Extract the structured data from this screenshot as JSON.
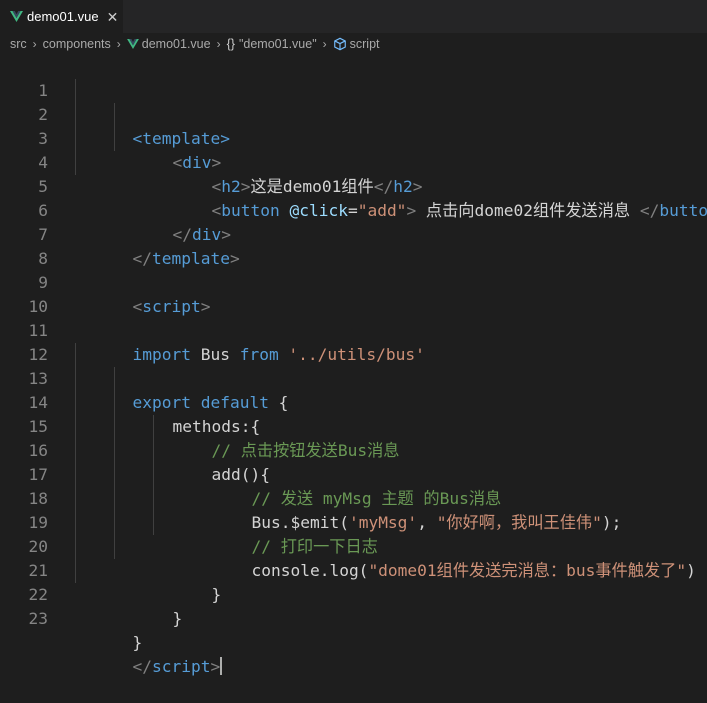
{
  "tab": {
    "title": "demo01.vue",
    "close": "✕"
  },
  "breadcrumb": {
    "items": [
      "src",
      "components",
      "demo01.vue",
      "\"demo01.vue\"",
      "script"
    ],
    "braces": "{}"
  },
  "code": {
    "l1": "<template>",
    "l2": {
      "open": "<",
      "tag": "div",
      "close": ">"
    },
    "l3": {
      "a": "<",
      "tag": "h2",
      "b": ">",
      "text": "这是demo01组件",
      "c": "</",
      "tag2": "h2",
      "d": ">"
    },
    "l4": {
      "a": "<",
      "tag": "button",
      "attr": " @click",
      "eq": "=",
      "val": "\"add\"",
      "b": ">",
      "text": " 点击向dome02组件发送消息 ",
      "c": "</",
      "tag2": "button",
      "d": ">"
    },
    "l5": {
      "a": "</",
      "tag": "div",
      "b": ">"
    },
    "l6": {
      "a": "</",
      "tag": "template",
      "b": ">"
    },
    "l8": {
      "a": "<",
      "tag": "script",
      "b": ">"
    },
    "l10": {
      "kw1": "import",
      "name": " Bus ",
      "kw2": "from",
      "str": " '../utils/bus'"
    },
    "l12": {
      "kw1": "export",
      "kw2": " default",
      "rest": " {"
    },
    "l13": "methods:{",
    "l14": "// 点击按钮发送Bus消息",
    "l15": "add(){",
    "l16": "// 发送 myMsg 主题 的Bus消息",
    "l17": {
      "a": "Bus.$emit(",
      "s1": "'myMsg'",
      "b": ", ",
      "s2": "\"你好啊，我叫王佳伟\"",
      "c": ");"
    },
    "l18": "// 打印一下日志",
    "l19": {
      "a": "console.log(",
      "s": "\"dome01组件发送完消息：bus事件触发了\"",
      "b": ")"
    },
    "l20": "}",
    "l21": "}",
    "l22": "}",
    "l23": {
      "a": "</",
      "tag": "script",
      "b": ">"
    }
  },
  "line_numbers": [
    "1",
    "2",
    "3",
    "4",
    "5",
    "6",
    "7",
    "8",
    "9",
    "10",
    "11",
    "12",
    "13",
    "14",
    "15",
    "16",
    "17",
    "18",
    "19",
    "20",
    "21",
    "22",
    "23"
  ],
  "colors": {
    "background": "#1e1e1e",
    "tag": "#569cd6",
    "string": "#ce9178",
    "comment": "#6a9955",
    "attribute": "#9cdcfe",
    "vue": "#41b883"
  }
}
